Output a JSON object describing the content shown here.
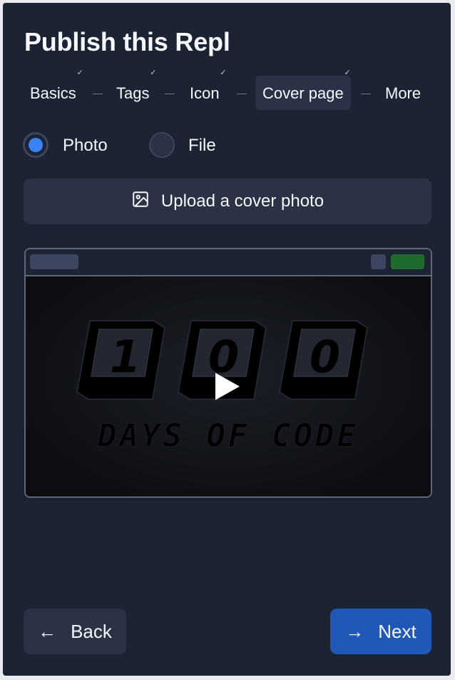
{
  "dialog": {
    "title": "Publish this Repl"
  },
  "steps": [
    {
      "label": "Basics",
      "completed": true
    },
    {
      "label": "Tags",
      "completed": true
    },
    {
      "label": "Icon",
      "completed": true
    },
    {
      "label": "Cover page",
      "completed": true,
      "active": true
    },
    {
      "label": "More",
      "completed": false
    }
  ],
  "cover_type": {
    "options": [
      {
        "label": "Photo",
        "selected": true
      },
      {
        "label": "File",
        "selected": false
      }
    ]
  },
  "upload": {
    "label": "Upload a cover photo",
    "icon": "image-icon"
  },
  "preview": {
    "artwork_text": [
      "1",
      "0",
      "0",
      "DAYS OF CODE"
    ],
    "play_icon": "play-icon"
  },
  "footer": {
    "back_label": "Back",
    "next_label": "Next"
  },
  "colors": {
    "background": "#1c2333",
    "surface": "#2b3245",
    "accent": "#3b82f6",
    "primary_button": "#1f58b6",
    "text": "#f5f9fc"
  }
}
